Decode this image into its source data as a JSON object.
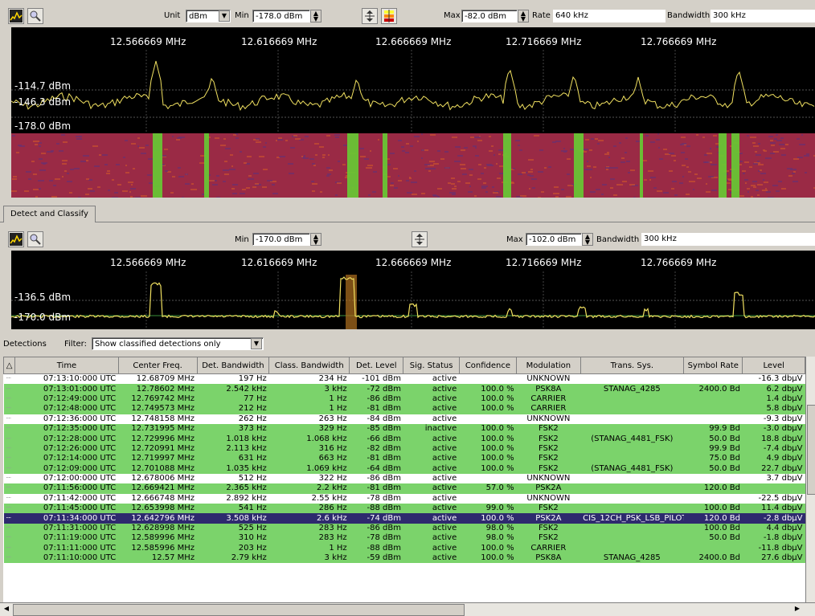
{
  "top": {
    "unit_label": "Unit",
    "unit_value": "dBm",
    "min_label": "Min",
    "min_value": "-178.0 dBm",
    "max_label": "Max",
    "max_value": "-82.0 dBm",
    "rate_label": "Rate",
    "rate_value": "640 kHz",
    "bandwidth_label": "Bandwidth",
    "bandwidth_value": "300 kHz",
    "freqs": [
      "12.566669 MHz",
      "12.616669 MHz",
      "12.666669 MHz",
      "12.716669 MHz",
      "12.766669 MHz"
    ],
    "level_top": "-114.7 dBm",
    "level_mid": "-146.3 dBm",
    "level_bottom": "-178.0 dBm"
  },
  "tab": {
    "label": "Detect and Classify"
  },
  "bottom": {
    "min_label": "Min",
    "min_value": "-170.0 dBm",
    "max_label": "Max",
    "max_value": "-102.0 dBm",
    "bandwidth_label": "Bandwidth",
    "bandwidth_value": "300 kHz",
    "freqs": [
      "12.566669 MHz",
      "12.616669 MHz",
      "12.666669 MHz",
      "12.716669 MHz",
      "12.766669 MHz"
    ],
    "level_top": "-136.5 dBm",
    "level_bottom": "-170.0 dBm"
  },
  "detections": {
    "label": "Detections",
    "filter_label": "Filter:",
    "filter_value": "Show classified detections only",
    "columns": [
      "Time",
      "Center Freq.",
      "Det. Bandwidth",
      "Class. Bandwidth",
      "Det. Level",
      "Sig. Status",
      "Confidence",
      "Modulation",
      "Trans. Sys.",
      "Symbol Rate",
      "Level"
    ],
    "rows": [
      {
        "k": "unc",
        "c": [
          "07:13:10:000 UTC",
          "12.68709 MHz",
          "197 Hz",
          "234 Hz",
          "-101 dBm",
          "active",
          "",
          "UNKNOWN",
          "",
          "",
          "-16.3 dbµV"
        ]
      },
      {
        "k": "cls",
        "c": [
          "07:13:01:000 UTC",
          "12.78602 MHz",
          "2.542 kHz",
          "3 kHz",
          "-72 dBm",
          "active",
          "100.0 %",
          "PSK8A",
          "STANAG_4285",
          "2400.0 Bd",
          "6.2 dbµV"
        ]
      },
      {
        "k": "cls",
        "c": [
          "07:12:49:000 UTC",
          "12.769742 MHz",
          "77 Hz",
          "1 Hz",
          "-86 dBm",
          "active",
          "100.0 %",
          "CARRIER",
          "",
          "",
          "1.4 dbµV"
        ]
      },
      {
        "k": "cls",
        "c": [
          "07:12:48:000 UTC",
          "12.749573 MHz",
          "212 Hz",
          "1 Hz",
          "-81 dBm",
          "active",
          "100.0 %",
          "CARRIER",
          "",
          "",
          "5.8 dbµV"
        ]
      },
      {
        "k": "unc",
        "c": [
          "07:12:36:000 UTC",
          "12.748158 MHz",
          "262 Hz",
          "263 Hz",
          "-84 dBm",
          "active",
          "",
          "UNKNOWN",
          "",
          "",
          "-9.3 dbµV"
        ]
      },
      {
        "k": "cls",
        "c": [
          "07:12:35:000 UTC",
          "12.731995 MHz",
          "373 Hz",
          "329 Hz",
          "-85 dBm",
          "inactive",
          "100.0 %",
          "FSK2",
          "",
          "99.9 Bd",
          "-3.0 dbµV"
        ]
      },
      {
        "k": "cls",
        "c": [
          "07:12:28:000 UTC",
          "12.729996 MHz",
          "1.018 kHz",
          "1.068 kHz",
          "-66 dBm",
          "active",
          "100.0 %",
          "FSK2",
          "(STANAG_4481_FSK)",
          "50.0 Bd",
          "18.8 dbµV"
        ]
      },
      {
        "k": "cls",
        "c": [
          "07:12:26:000 UTC",
          "12.720991 MHz",
          "2.113 kHz",
          "316 Hz",
          "-82 dBm",
          "active",
          "100.0 %",
          "FSK2",
          "",
          "99.9 Bd",
          "-7.4 dbµV"
        ]
      },
      {
        "k": "cls",
        "c": [
          "07:12:14:000 UTC",
          "12.719997 MHz",
          "631 Hz",
          "663 Hz",
          "-81 dBm",
          "active",
          "100.0 %",
          "FSK2",
          "",
          "75.0 Bd",
          "4.9 dbµV"
        ]
      },
      {
        "k": "cls",
        "c": [
          "07:12:09:000 UTC",
          "12.701088 MHz",
          "1.035 kHz",
          "1.069 kHz",
          "-64 dBm",
          "active",
          "100.0 %",
          "FSK2",
          "(STANAG_4481_FSK)",
          "50.0 Bd",
          "22.7 dbµV"
        ]
      },
      {
        "k": "unc",
        "c": [
          "07:12:00:000 UTC",
          "12.678006 MHz",
          "512 Hz",
          "322 Hz",
          "-86 dBm",
          "active",
          "",
          "UNKNOWN",
          "",
          "",
          "3.7 dbµV"
        ]
      },
      {
        "k": "cls",
        "c": [
          "07:11:56:000 UTC",
          "12.669421 MHz",
          "2.365 kHz",
          "2.2 kHz",
          "-81 dBm",
          "active",
          "57.0 %",
          "PSK2A",
          "",
          "120.0 Bd",
          ""
        ]
      },
      {
        "k": "unc",
        "c": [
          "07:11:42:000 UTC",
          "12.666748 MHz",
          "2.892 kHz",
          "2.55 kHz",
          "-78 dBm",
          "active",
          "",
          "UNKNOWN",
          "",
          "",
          "-22.5 dbµV"
        ]
      },
      {
        "k": "cls",
        "c": [
          "07:11:45:000 UTC",
          "12.653998 MHz",
          "541 Hz",
          "286 Hz",
          "-88 dBm",
          "active",
          "99.0 %",
          "FSK2",
          "",
          "100.0 Bd",
          "11.4 dbµV"
        ]
      },
      {
        "k": "sel",
        "c": [
          "07:11:34:000 UTC",
          "12.642796 MHz",
          "3.508 kHz",
          "2.6 kHz",
          "-74 dBm",
          "active",
          "100.0 %",
          "PSK2A",
          "CIS_12CH_PSK_LSB_PILOT",
          "120.0 Bd",
          "-2.8 dbµV"
        ]
      },
      {
        "k": "cls",
        "c": [
          "07:11:31:000 UTC",
          "12.628998 MHz",
          "525 Hz",
          "283 Hz",
          "-86 dBm",
          "active",
          "98.0 %",
          "FSK2",
          "",
          "100.0 Bd",
          "4.4 dbµV"
        ]
      },
      {
        "k": "cls",
        "c": [
          "07:11:19:000 UTC",
          "12.589996 MHz",
          "310 Hz",
          "283 Hz",
          "-78 dBm",
          "active",
          "98.0 %",
          "FSK2",
          "",
          "50.0 Bd",
          "-1.8 dbµV"
        ]
      },
      {
        "k": "cls",
        "c": [
          "07:11:11:000 UTC",
          "12.585996 MHz",
          "203 Hz",
          "1 Hz",
          "-88 dBm",
          "active",
          "100.0 %",
          "CARRIER",
          "",
          "",
          "-11.8 dbµV"
        ]
      },
      {
        "k": "cls",
        "c": [
          "07:11:10:000 UTC",
          "12.57 MHz",
          "2.79 kHz",
          "3 kHz",
          "-59 dBm",
          "active",
          "100.0 %",
          "PSK8A",
          "STANAG_4285",
          "2400.0 Bd",
          "27.6 dbµV"
        ]
      }
    ]
  }
}
